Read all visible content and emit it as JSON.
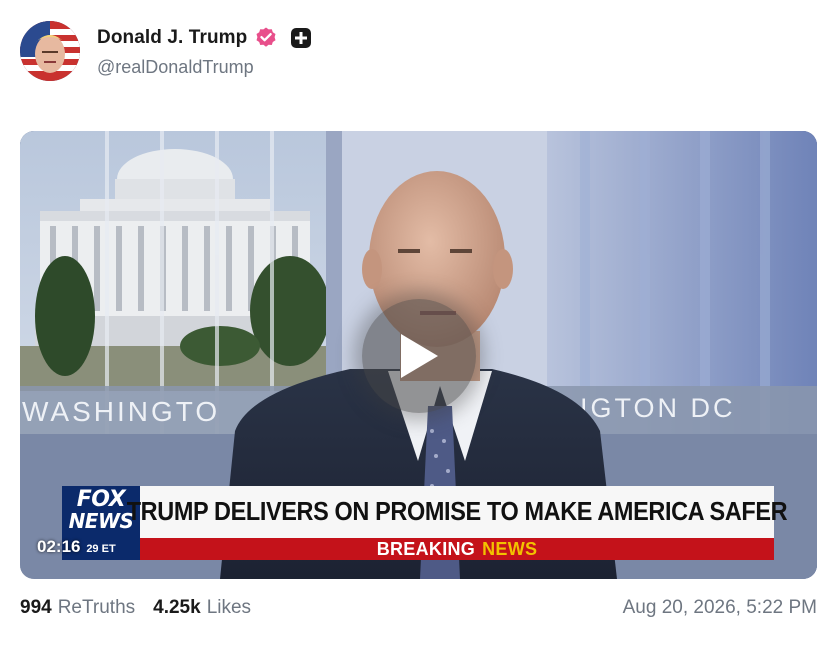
{
  "author": {
    "display_name": "Donald J. Trump",
    "handle": "@realDonaldTrump",
    "verified_color": "#e84f8b"
  },
  "video": {
    "duration": "02:16",
    "chyron": {
      "network_top": "FOX",
      "network_bottom": "NEWS",
      "headline": "TRUMP DELIVERS ON PROMISE TO MAKE AMERICA SAFER",
      "breaking_word": "BREAKING",
      "news_word": "NEWS",
      "local_time": "29 ET"
    },
    "backdrop_text_left": "WASHINGTO",
    "backdrop_text_right": "IGTON DC"
  },
  "stats": {
    "retruths_count": "994",
    "retruths_label": "ReTruths",
    "likes_count": "4.25k",
    "likes_label": "Likes"
  },
  "timestamp": "Aug 20, 2026, 5:22 PM",
  "colors": {
    "fox_blue": "#0b2a6b",
    "breaking_red": "#c4121a",
    "news_yellow": "#f2c200"
  }
}
